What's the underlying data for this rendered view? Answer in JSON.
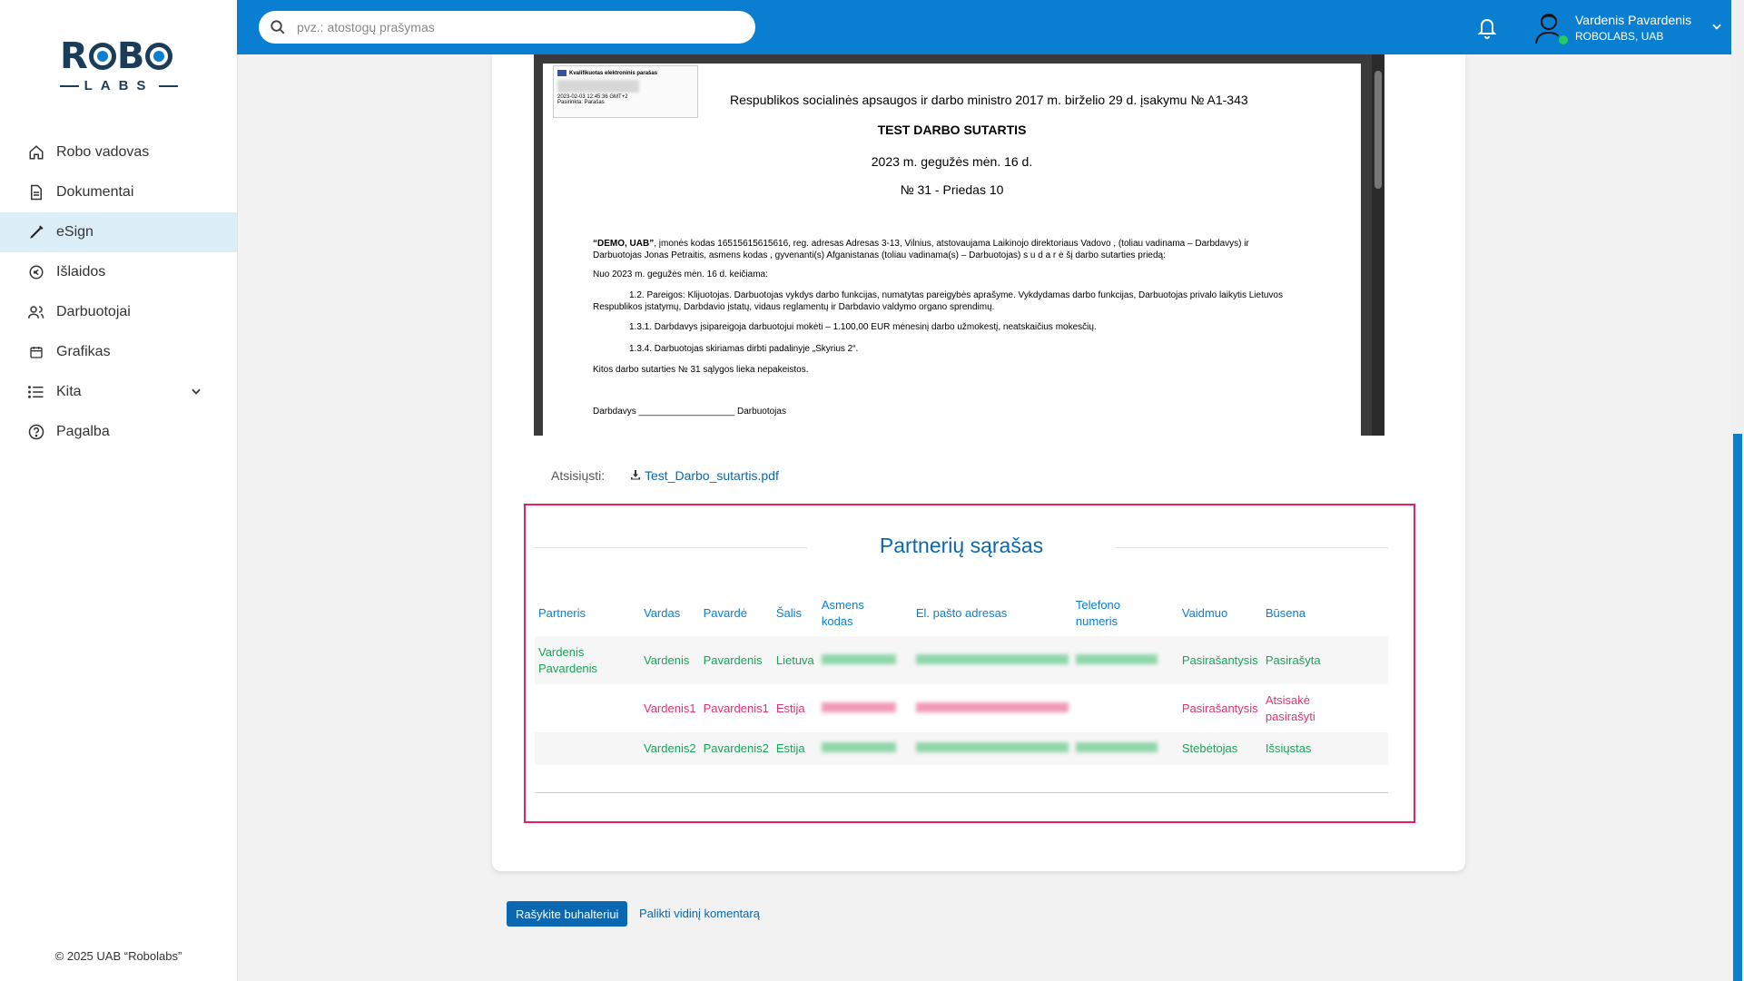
{
  "sidebar": {
    "logo_top": "ROBO",
    "logo_bottom": "LABS",
    "items": [
      {
        "label": "Robo vadovas",
        "icon": "home-icon"
      },
      {
        "label": "Dokumentai",
        "icon": "document-icon"
      },
      {
        "label": "eSign",
        "icon": "pen-icon",
        "active": true
      },
      {
        "label": "Išlaidos",
        "icon": "expense-icon"
      },
      {
        "label": "Darbuotojai",
        "icon": "users-icon"
      },
      {
        "label": "Grafikas",
        "icon": "calendar-icon"
      },
      {
        "label": "Kita",
        "icon": "list-icon",
        "has_chevron": true
      },
      {
        "label": "Pagalba",
        "icon": "help-icon"
      }
    ],
    "copyright": "© 2025 UAB “Robolabs”"
  },
  "topbar": {
    "search_placeholder": "pvz.: atostogų prašymas",
    "user_name": "Vardenis Pavardenis",
    "user_company": "ROBOLABS, UAB"
  },
  "document": {
    "sig_title": "Kvalifikuotas elektroninis parašas",
    "sig_date": "2023-02-03 12:45:36 GMT+2",
    "sig_reason": "Pasirinkta: Parašas",
    "header_line": "Respublikos socialinės apsaugos ir darbo ministro 2017 m. birželio 29 d. įsakymu № A1-343",
    "title": "TEST DARBO SUTARTIS",
    "date": "2023 m. gegužės mėn. 16 d.",
    "number": "№ 31 - Priedas 10",
    "para1_a": "“DEMO, UAB”",
    "para1_b": ", įmonės kodas 16515615615616, reg. adresas Adresas 3-13, Vilnius, atstovaujama Laikinojo direktoriaus Vadovo , (toliau vadinama – Darbdavys) ir",
    "para1_c": "Darbuotojas Jonas Petraitis, asmens kodas , gyvenanti(s) Afganistanas (toliau vadinama(s) – Darbuotojas) s u d a r ė šį darbo sutarties priedą:",
    "para2": "Nuo 2023 m. gegužės mėn. 16 d. keičiama:",
    "para3_a": "1.2. Pareigos: Klijuotojas. Darbuotojas vykdys darbo funkcijas, numatytas pareigybės aprašyme. Vykdydamas darbo funkcijas, Darbuotojas privalo laikytis Lietuvos",
    "para3_b": "Respublikos įstatymų, Darbdavio įstatų, vidaus reglamentų ir Darbdavio valdymo organo sprendimų.",
    "para4": "1.3.1. Darbdavys įsipareigoja darbuotojui mokėti – 1.100,00 EUR mėnesinį darbo užmokestį, neatskaičius mokesčių.",
    "para5": "1.3.4. Darbuotojas skiriamas dirbti padalinyje „Skyrius 2“.",
    "para6": "Kitos darbo sutarties № 31 sąlygos lieka nepakeistos.",
    "sign_line": "Darbdavys ___________________ Darbuotojas"
  },
  "download": {
    "label": "Atsisiųsti:",
    "filename": "Test_Darbo_sutartis.pdf"
  },
  "partners": {
    "title": "Partnerių sąrašas",
    "headers": {
      "partner": "Partneris",
      "first": "Vardas",
      "last": "Pavardė",
      "country": "Šalis",
      "code_1": "Asmens",
      "code_2": "kodas",
      "email": "El. pašto adresas",
      "phone_1": "Telefono",
      "phone_2": "numeris",
      "role": "Vaidmuo",
      "status": "Būsena"
    },
    "rows": [
      {
        "partner_1": "Vardenis",
        "partner_2": "Pavardenis",
        "first": "Vardenis",
        "last": "Pavardenis",
        "country": "Lietuva",
        "role": "Pasirašantysis",
        "status_1": "Pasirašyta",
        "status_2": "",
        "color": "#1aa35a"
      },
      {
        "partner_1": "",
        "partner_2": "",
        "first": "Vardenis1",
        "last": "Pavardenis1",
        "country": "Estija",
        "role": "Pasirašantysis",
        "status_1": "Atsisakė",
        "status_2": "pasirašyti",
        "color": "#e0336b"
      },
      {
        "partner_1": "",
        "partner_2": "",
        "first": "Vardenis2",
        "last": "Pavardenis2",
        "country": "Estija",
        "role": "Stebėtojas",
        "status_1": "Išsiųstas",
        "status_2": "",
        "color": "#1aa35a"
      }
    ]
  },
  "actions": {
    "write_accountant": "Rašykite buhalteriui",
    "leave_comment": "Palikti vidinį komentarą"
  },
  "colors": {
    "brand": "#0a7fd1",
    "success": "#1aa35a",
    "danger": "#e0336b",
    "highlight_border": "#e91e63"
  }
}
